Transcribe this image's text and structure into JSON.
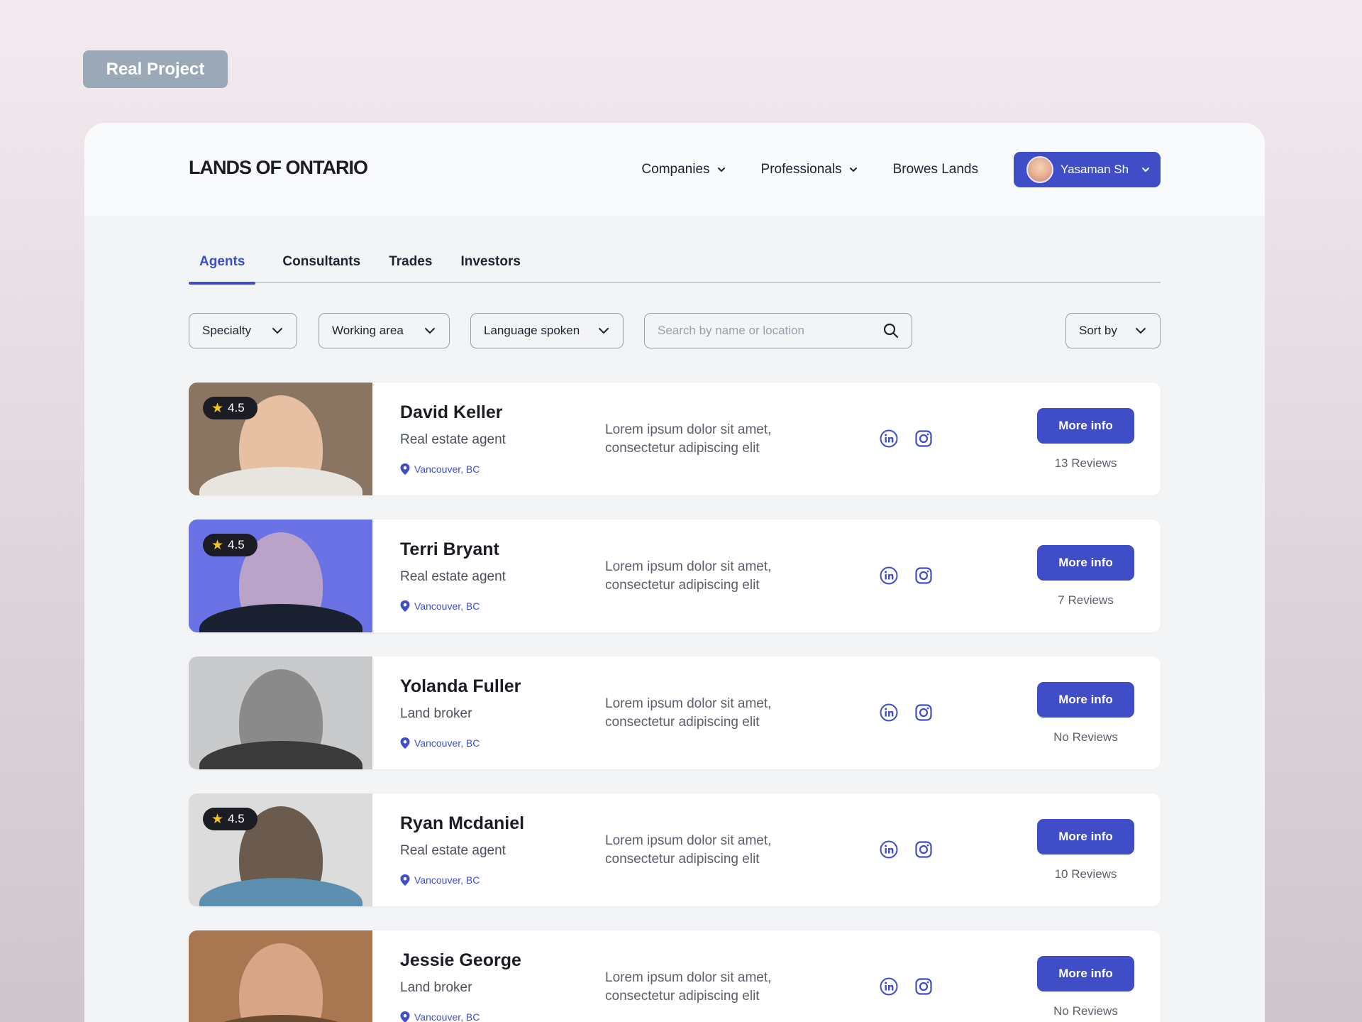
{
  "badge": "Real Project",
  "header": {
    "logo": "LANDS OF ONTARIO",
    "nav": [
      {
        "label": "Companies",
        "dropdown": true
      },
      {
        "label": "Professionals",
        "dropdown": true
      },
      {
        "label": "Browes Lands",
        "dropdown": false
      }
    ],
    "user": {
      "name": "Yasaman Sh"
    }
  },
  "tabs": [
    {
      "label": "Agents",
      "active": true
    },
    {
      "label": "Consultants",
      "active": false
    },
    {
      "label": "Trades",
      "active": false
    },
    {
      "label": "Investors",
      "active": false
    }
  ],
  "filters": {
    "specialty": "Specialty",
    "working_area": "Working area",
    "language": "Language spoken",
    "search_placeholder": "Search by name or location",
    "sort": "Sort by"
  },
  "agents": [
    {
      "name": "David Keller",
      "role": "Real estate agent",
      "location": "Vancouver, BC",
      "rating": "4.5",
      "description": "Lorem ipsum dolor sit amet, consectetur adipiscing elit",
      "button": "More info",
      "reviews": "13 Reviews",
      "photo_bg": "#8a7462",
      "photo_skin": "#e7bfa3",
      "photo_shirt": "#e8e4e0"
    },
    {
      "name": "Terri Bryant",
      "role": "Real estate agent",
      "location": "Vancouver, BC",
      "rating": "4.5",
      "description": "Lorem ipsum dolor sit amet, consectetur adipiscing elit",
      "button": "More info",
      "reviews": "7 Reviews",
      "photo_bg": "#6a72e6",
      "photo_skin": "#b9a3c8",
      "photo_shirt": "#1b2030"
    },
    {
      "name": "Yolanda Fuller",
      "role": "Land broker",
      "location": "Vancouver, BC",
      "rating": "",
      "description": "Lorem ipsum dolor sit amet, consectetur adipiscing elit",
      "button": "More info",
      "reviews": "No Reviews",
      "photo_bg": "#c9cacc",
      "photo_skin": "#8a8a8a",
      "photo_shirt": "#3a3a3a"
    },
    {
      "name": "Ryan Mcdaniel",
      "role": "Real estate agent",
      "location": "Vancouver, BC",
      "rating": "4.5",
      "description": "Lorem ipsum dolor sit amet, consectetur adipiscing elit",
      "button": "More info",
      "reviews": "10 Reviews",
      "photo_bg": "#dcdcdc",
      "photo_skin": "#6b5a4e",
      "photo_shirt": "#5d8fb0"
    },
    {
      "name": "Jessie George",
      "role": "Land broker",
      "location": "Vancouver, BC",
      "rating": "",
      "description": "Lorem ipsum dolor sit amet, consectetur adipiscing elit",
      "button": "More info",
      "reviews": "No Reviews",
      "photo_bg": "#a87650",
      "photo_skin": "#d9a587",
      "photo_shirt": "#6b4a30"
    }
  ],
  "colors": {
    "accent": "#3f4ec6",
    "dark": "#1c1c24",
    "star": "#f5c518"
  }
}
